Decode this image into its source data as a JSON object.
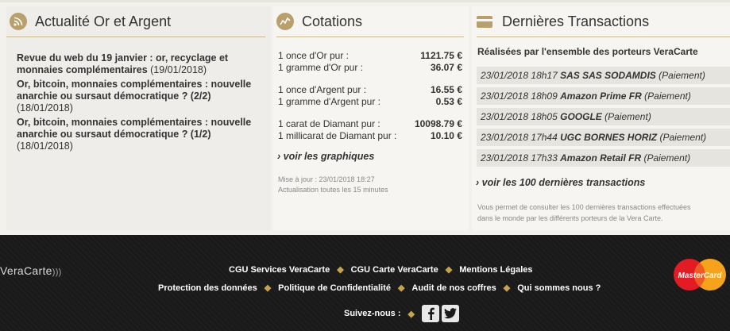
{
  "news": {
    "title": "Actualité Or et Argent",
    "items": [
      {
        "title": "Revue du web du 19 janvier : or, recyclage et monnaies complémentaires",
        "date": "(19/01/2018)"
      },
      {
        "title": "Or, bitcoin, monnaies complémentaires : nouvelle anarchie ou sursaut démocratique ? (2/2)",
        "date": "(18/01/2018)"
      },
      {
        "title": "Or, bitcoin, monnaies complémentaires : nouvelle anarchie ou sursaut démocratique ? (1/2)",
        "date": "(18/01/2018)"
      }
    ]
  },
  "quotes": {
    "title": "Cotations",
    "gold": [
      {
        "label": "1 once d'Or pur :",
        "value": "1121.75 €"
      },
      {
        "label": "1 gramme d'Or pur :",
        "value": "36.07 €"
      }
    ],
    "silver": [
      {
        "label": "1 once d'Argent pur :",
        "value": "16.55 €"
      },
      {
        "label": "1 gramme d'Argent pur :",
        "value": "0.53 €"
      }
    ],
    "diamond": [
      {
        "label": "1 carat de Diamant pur :",
        "value": "10098.79 €"
      },
      {
        "label": "1 millicarat de Diamant pur :",
        "value": "10.10 €"
      }
    ],
    "charts_link": "voir les graphiques",
    "updated": "Mise à jour : 23/01/2018 18:27",
    "refresh": "Actualisation toutes les 15 minutes"
  },
  "transactions": {
    "title": "Dernières Transactions",
    "subtitle": "Réalisées par l'ensemble des porteurs VeraCarte",
    "rows": [
      {
        "datetime": "23/01/2018 18h17",
        "merchant": "SAS SAS SODAMDIS",
        "type": "(Paiement)"
      },
      {
        "datetime": "23/01/2018 18h09",
        "merchant": "Amazon Prime FR",
        "type": "(Paiement)"
      },
      {
        "datetime": "23/01/2018 18h05",
        "merchant": "GOOGLE",
        "type": "(Paiement)"
      },
      {
        "datetime": "23/01/2018 17h44",
        "merchant": "UGC BORNES HORIZ",
        "type": "(Paiement)"
      },
      {
        "datetime": "23/01/2018 17h33",
        "merchant": "Amazon Retail FR",
        "type": "(Paiement)"
      }
    ],
    "more_link": "voir les 100 dernières transactions",
    "desc_line1": "Vous permet de consulter les 100 dernières transactions effectuées",
    "desc_line2": "dans le monde par les différents porteurs de la Vera Carte."
  },
  "footer": {
    "logo": "VeraCarte",
    "row1": [
      "CGU Services VeraCarte",
      "CGU Carte VeraCarte",
      "Mentions Légales"
    ],
    "row2": [
      "Protection des données",
      "Politique de Confidentialité",
      "Audit de nos coffres",
      "Qui sommes nous ?"
    ],
    "follow": "Suivez-nous :",
    "mastercard": "MasterCard"
  },
  "colors": {
    "accent": "#b8a06a",
    "separator": "#c7a34b",
    "footer_bg": "#1a1a1a"
  }
}
